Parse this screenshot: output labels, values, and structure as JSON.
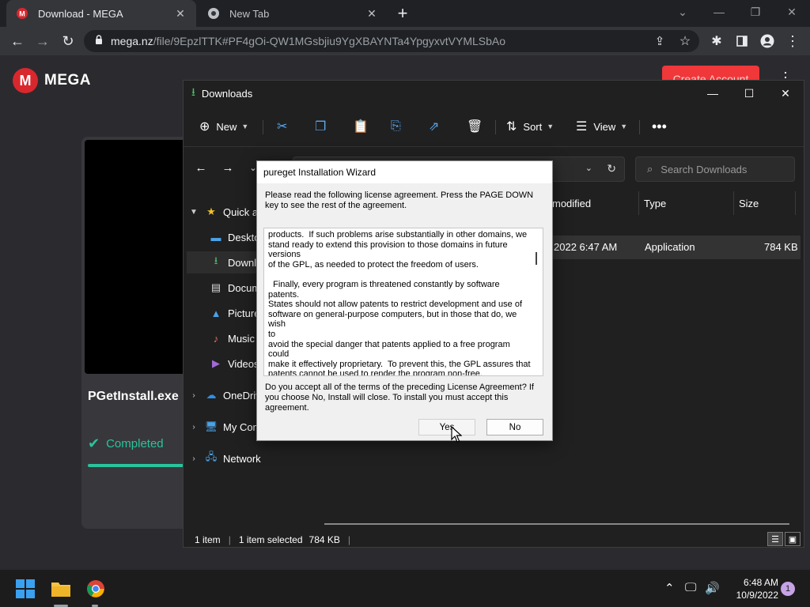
{
  "browser": {
    "tabs": [
      {
        "title": "Download - MEGA"
      },
      {
        "title": "New Tab"
      }
    ],
    "url_host": "mega.nz",
    "url_path": "/file/9EpzlTTK#PF4gOi-QW1MGsbjiu9YgXBAYNTa4YpgyxvtVYMLSbAo"
  },
  "mega": {
    "brand": "MEGA",
    "logo_letter": "M",
    "create_account": "Create Account",
    "file_name": "PGetInstall.exe",
    "status": "Completed",
    "progress": 1.0,
    "accent": "#d9272e",
    "success_color": "#29c39d"
  },
  "explorer": {
    "title": "Downloads",
    "commands": {
      "new": "New",
      "sort": "Sort",
      "view": "View"
    },
    "search_placeholder": "Search Downloads",
    "sidebar": [
      {
        "label": "Quick access",
        "icon": "star-icon"
      },
      {
        "label": "Desktop",
        "icon": "desktop-icon"
      },
      {
        "label": "Downloads",
        "icon": "download-icon"
      },
      {
        "label": "Documents",
        "icon": "documents-icon"
      },
      {
        "label": "Pictures",
        "icon": "pictures-icon"
      },
      {
        "label": "Music",
        "icon": "music-icon"
      },
      {
        "label": "Videos",
        "icon": "videos-icon"
      },
      {
        "label": "OneDrive",
        "icon": "cloud-icon"
      },
      {
        "label": "My Computer",
        "icon": "computer-icon"
      },
      {
        "label": "Network",
        "icon": "network-icon"
      }
    ],
    "columns": {
      "modified": "modified",
      "type": "Type",
      "size": "Size"
    },
    "file_row": {
      "date": "2022 6:47 AM",
      "type": "Application",
      "size": "784 KB"
    },
    "status": {
      "count": "1 item",
      "selected": "1 item selected",
      "size": "784 KB"
    }
  },
  "dialog": {
    "title": "pureget Installation Wizard",
    "intro": "Please read the following license agreement. Press the PAGE DOWN key to see the rest of the agreement.",
    "license_text": "products.  If such problems arise substantially in other domains, we\nstand ready to extend this provision to those domains in future\nversions\nof the GPL, as needed to protect the freedom of users.\n\n  Finally, every program is threatened constantly by software patents.\nStates should not allow patents to restrict development and use of\nsoftware on general-purpose computers, but in those that do, we wish\nto\navoid the special danger that patents applied to a free program could\nmake it effectively proprietary.  To prevent this, the GPL assures that\npatents cannot be used to render the program non-free.\n\n  The precise terms and conditions for copying, distribution and\nmodification follow.",
    "question": "Do you accept all of the terms of the preceding License Agreement? If you choose No, Install will close. To install you must accept this agreement.",
    "yes": "Yes",
    "no": "No"
  },
  "taskbar": {
    "time": "6:48 AM",
    "date": "10/9/2022",
    "notifications": "1"
  }
}
